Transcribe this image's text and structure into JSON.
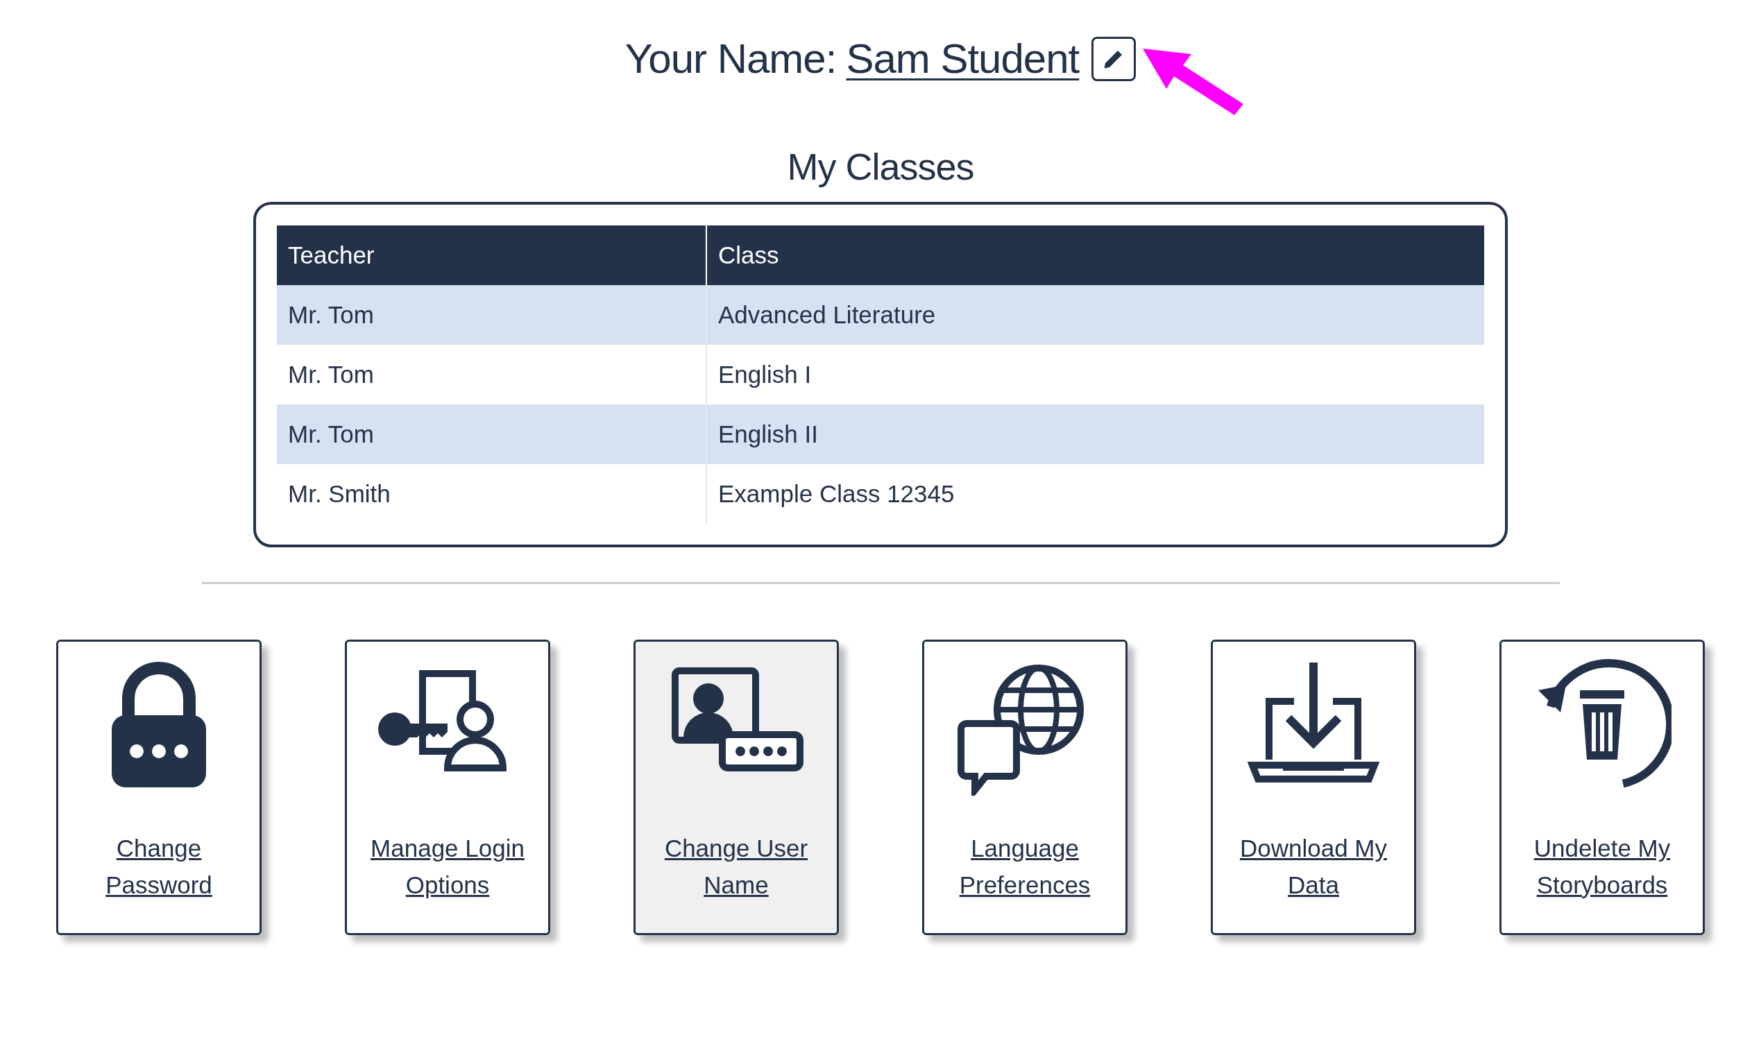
{
  "profile": {
    "label": "Your Name:",
    "name": "Sam Student"
  },
  "classes": {
    "title": "My Classes",
    "columns": [
      "Teacher",
      "Class"
    ],
    "rows": [
      [
        "Mr. Tom",
        "Advanced Literature"
      ],
      [
        "Mr. Tom",
        "English I"
      ],
      [
        "Mr. Tom",
        "English II"
      ],
      [
        "Mr. Smith",
        "Example Class 12345"
      ]
    ]
  },
  "actions": [
    {
      "kind": "lock",
      "label": "Change Password",
      "highlighted": false
    },
    {
      "kind": "login",
      "label": "Manage Login Options",
      "highlighted": false
    },
    {
      "kind": "username",
      "label": "Change User Name",
      "highlighted": true
    },
    {
      "kind": "language",
      "label": "Language Preferences",
      "highlighted": false
    },
    {
      "kind": "download",
      "label": "Download My Data",
      "highlighted": false
    },
    {
      "kind": "undelete",
      "label": "Undelete My Storyboards",
      "highlighted": false
    }
  ]
}
